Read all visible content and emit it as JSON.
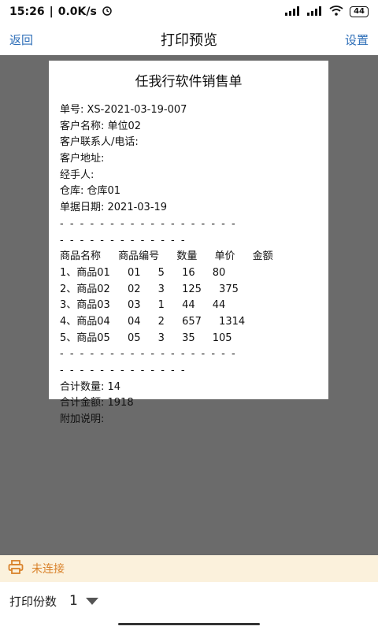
{
  "status_bar": {
    "time": "15:26",
    "network_speed": "0.0K/s",
    "battery_level": "44"
  },
  "nav": {
    "back_label": "返回",
    "title": "打印预览",
    "settings_label": "设置"
  },
  "receipt": {
    "title": "任我行软件销售单",
    "order_no": "单号: XS-2021-03-19-007",
    "customer_name": "客户名称: 单位02",
    "customer_contact": "客户联系人/电话:",
    "customer_address": "客户地址:",
    "handler": "经手人:",
    "warehouse": "仓库: 仓库01",
    "doc_date": "单据日期: 2021-03-19",
    "dash_line_1": "- - - - - - - - - - - - - - - - - -",
    "dash_line_2": "- - - - - - - - - - - - -",
    "columns": [
      "商品名称",
      "商品编号",
      "数量",
      "单价",
      "金额"
    ],
    "rows": [
      [
        "1、商品01",
        "01",
        "5",
        "16",
        "80"
      ],
      [
        "2、商品02",
        "02",
        "3",
        "125",
        "375"
      ],
      [
        "3、商品03",
        "03",
        "1",
        "44",
        "44"
      ],
      [
        "4、商品04",
        "04",
        "2",
        "657",
        "1314"
      ],
      [
        "5、商品05",
        "05",
        "3",
        "35",
        "105"
      ]
    ],
    "total_qty": "合计数量: 14",
    "total_amount": "合计金额: 1918",
    "remarks": "附加说明:"
  },
  "footer": {
    "connection_status": "未连接",
    "copies_label": "打印份数",
    "copies_value": "1"
  },
  "colors": {
    "accent_blue": "#2f6fb8",
    "warning_orange": "#d9822b",
    "background_gray": "#6b6b6b"
  }
}
